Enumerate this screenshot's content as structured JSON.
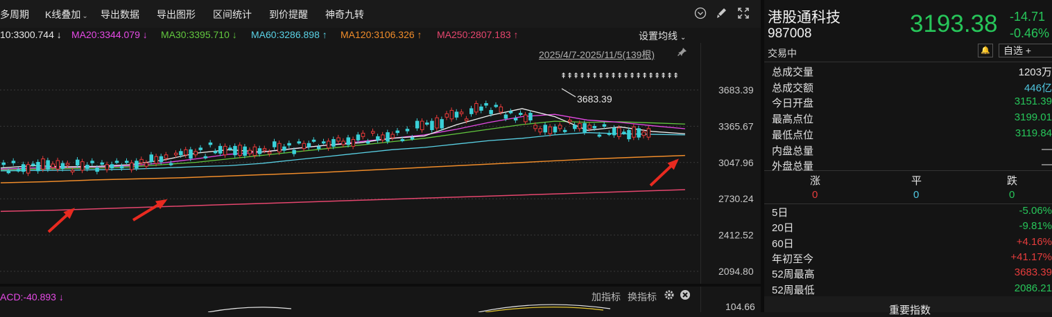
{
  "toolbar": {
    "items": [
      "多周期",
      "K线叠加",
      "导出数据",
      "导出图形",
      "区间统计",
      "到价提醒",
      "神奇九转"
    ],
    "dropdown_caret": "⌄"
  },
  "ma_legend": [
    {
      "text": "10:3300.744 ↓",
      "color": "#e8e8e8"
    },
    {
      "text": "MA20:3344.079 ↓",
      "color": "#e64ae6"
    },
    {
      "text": "MA30:3395.710 ↓",
      "color": "#62c83e"
    },
    {
      "text": "MA60:3286.898 ↑",
      "color": "#5ad2e6"
    },
    {
      "text": "MA120:3106.326 ↑",
      "color": "#f08c2a"
    },
    {
      "text": "MA250:2807.183 ↑",
      "color": "#e6466e"
    }
  ],
  "settings_label": "设置均线",
  "range_label": "2025/4/7-2025/11/5(139根)",
  "high_marker": "3683.39",
  "y_ticks": [
    "3683.39",
    "3365.67",
    "3047.96",
    "2730.24",
    "2412.52",
    "2094.80"
  ],
  "macd": {
    "label": "ACD:-40.893 ↓",
    "add_indicator": "加指标",
    "switch_indicator": "换指标",
    "axis_value": "104.66"
  },
  "chart_data": {
    "type": "candlestick",
    "ylim": [
      2094.8,
      3683.39
    ],
    "ma120": [
      2870,
      2880,
      2895,
      2905,
      2915,
      2930,
      2945,
      2960,
      2980,
      3000,
      3020,
      3040,
      3060,
      3080,
      3095,
      3110
    ],
    "ma250": [
      2620,
      2630,
      2645,
      2660,
      2675,
      2690,
      2705,
      2720,
      2735,
      2750,
      2765,
      2780,
      2795,
      2810
    ],
    "highest": 3683.39
  },
  "quote": {
    "name": "港股通科技",
    "code": "987008",
    "price": "3193.38",
    "change": "-14.71",
    "change_pct": "-0.46%",
    "status": "交易中",
    "watch_label": "自选 +",
    "bell": "🔔"
  },
  "stats": [
    {
      "label": "总成交量",
      "value": "1203万",
      "color": "#e6e6e6"
    },
    {
      "label": "总成交额",
      "value": "446亿",
      "color": "#4fc6e0"
    },
    {
      "label": "今日开盘",
      "value": "3151.39",
      "color": "#27c65a"
    },
    {
      "label": "最高点位",
      "value": "3199.01",
      "color": "#27c65a"
    },
    {
      "label": "最低点位",
      "value": "3119.84",
      "color": "#27c65a"
    },
    {
      "label": "内盘总量",
      "value": "—",
      "color": "#e6e6e6"
    },
    {
      "label": "外盘总量",
      "value": "—",
      "color": "#e6e6e6"
    }
  ],
  "breadth": {
    "headers": [
      "涨",
      "平",
      "跌"
    ],
    "values": [
      "0",
      "0",
      "0"
    ],
    "colors": [
      "#e63c3c",
      "#4fc6e0",
      "#27c65a"
    ]
  },
  "periods": [
    {
      "label": "5日",
      "value": "-5.06%",
      "color": "#27c65a"
    },
    {
      "label": "20日",
      "value": "-9.81%",
      "color": "#27c65a"
    },
    {
      "label": "60日",
      "value": "+4.16%",
      "color": "#e63c3c"
    },
    {
      "label": "年初至今",
      "value": "+41.17%",
      "color": "#e63c3c"
    },
    {
      "label": "52周最高",
      "value": "3683.39",
      "color": "#e63c3c"
    },
    {
      "label": "52周最低",
      "value": "2086.21",
      "color": "#27c65a"
    }
  ],
  "bottom_title": "重要指数"
}
